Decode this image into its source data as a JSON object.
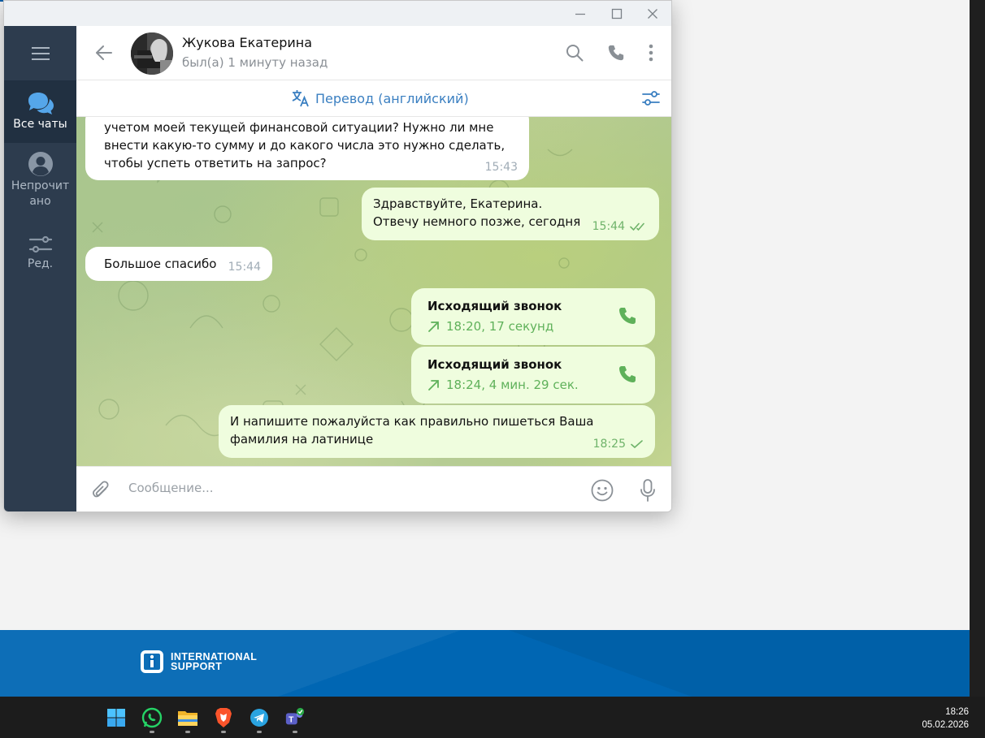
{
  "window": {
    "minimize_icon": "minimize-icon",
    "maximize_icon": "maximize-icon",
    "close_icon": "close-icon"
  },
  "sidebar": {
    "menu_icon": "hamburger-menu-icon",
    "items": [
      {
        "label": "Все чаты",
        "icon": "chats-icon",
        "active": true
      },
      {
        "label": "Непрочитано",
        "label_line1": "Непрочит",
        "label_line2": "ано",
        "icon": "user-circle-icon"
      },
      {
        "label": "Ред.",
        "icon": "sliders-icon"
      }
    ]
  },
  "header": {
    "contact_name": "Жукова Екатерина",
    "status": "был(а) 1 минуту назад",
    "back_icon": "arrow-left-icon",
    "search_icon": "search-icon",
    "call_icon": "phone-icon",
    "more_icon": "more-vertical-icon"
  },
  "translation": {
    "label": "Перевод (английский)",
    "icon": "translate-icon",
    "settings_icon": "filter-settings-icon"
  },
  "messages": [
    {
      "dir": "in",
      "lines": [
        "учетом моей текущей финансовой ситуации? Нужно ли мне",
        "внести какую-то сумму и до какого числа это нужно сделать,",
        "чтобы успеть ответить на запрос?"
      ],
      "time": "15:43"
    },
    {
      "dir": "out",
      "lines": [
        "Здравствуйте, Екатерина.",
        "Отвечу немного позже, сегодня"
      ],
      "time": "15:44",
      "status": "read"
    },
    {
      "dir": "in",
      "lines": [
        "Большое спасибо"
      ],
      "time": "15:44"
    },
    {
      "dir": "out",
      "type": "call",
      "title": "Исходящий звонок",
      "info": "18:20, 17 секунд"
    },
    {
      "dir": "out",
      "type": "call",
      "title": "Исходящий звонок",
      "info": "18:24, 4 мин. 29 сек."
    },
    {
      "dir": "out",
      "lines": [
        "И напишите пожалуйста как правильно пишеться Ваша",
        "фамилия на латинице"
      ],
      "time": "18:25",
      "status": "sent"
    }
  ],
  "composer": {
    "placeholder": "Сообщение...",
    "attach_icon": "paperclip-icon",
    "emoji_icon": "emoji-icon",
    "mic_icon": "microphone-icon"
  },
  "background_page": {
    "logo_line1": "INTERNATIONAL",
    "logo_line2": "SUPPORT",
    "accent": "#0066b3"
  },
  "taskbar": {
    "apps": [
      "windows-start-icon",
      "whatsapp-icon",
      "file-explorer-icon",
      "brave-browser-icon",
      "telegram-icon",
      "teams-icon"
    ],
    "time": "18:26",
    "date": "05.02.2026"
  },
  "colors": {
    "sidebar_bg": "#2d3c4e",
    "sidebar_active": "#213041",
    "accent_blue": "#3a7fc1",
    "outgoing_bubble": "#effdde",
    "check_green": "#6fb36a"
  }
}
